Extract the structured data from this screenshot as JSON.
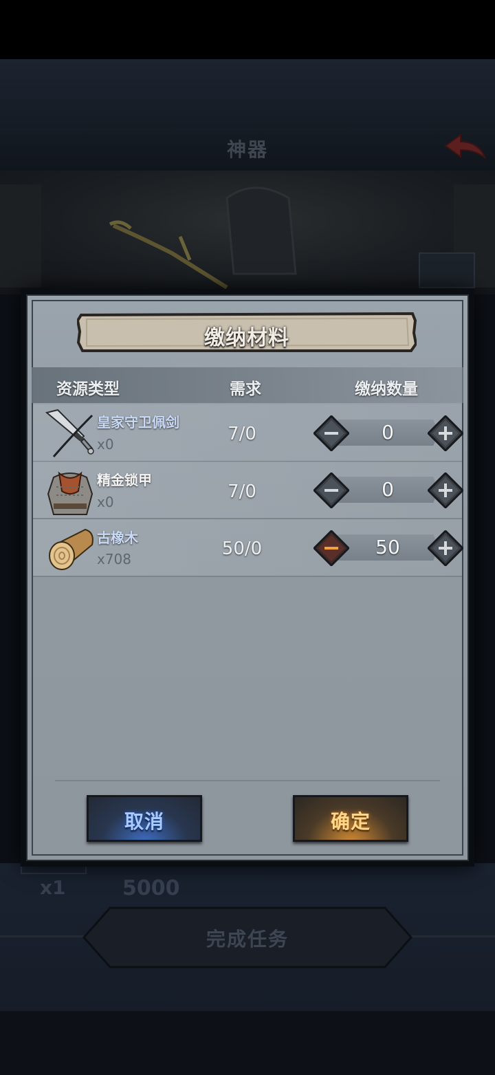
{
  "background": {
    "title": "神器",
    "reward_qty": "x1",
    "reward_amount": "5000",
    "complete_button": "完成任务"
  },
  "dialog": {
    "title": "缴纳材料",
    "headers": {
      "type": "资源类型",
      "required": "需求",
      "submit_qty": "缴纳数量"
    },
    "rows": [
      {
        "name": "皇家守卫佩剑",
        "owned": "x0",
        "required": "7/0",
        "quantity": "0",
        "icon": "sword-icon",
        "minus_active": false
      },
      {
        "name": "精金锁甲",
        "owned": "x0",
        "required": "7/0",
        "quantity": "0",
        "icon": "chainmail-icon",
        "minus_active": false
      },
      {
        "name": "古橡木",
        "owned": "x708",
        "required": "50/0",
        "quantity": "50",
        "icon": "oak-log-icon",
        "minus_active": true
      }
    ],
    "cancel_label": "取消",
    "confirm_label": "确定"
  },
  "colors": {
    "dialog_bg": "#9098a0",
    "cancel_glow": "#3f6ec4",
    "confirm_glow": "#d68d34",
    "item_name_blue": "#c9daf7"
  }
}
